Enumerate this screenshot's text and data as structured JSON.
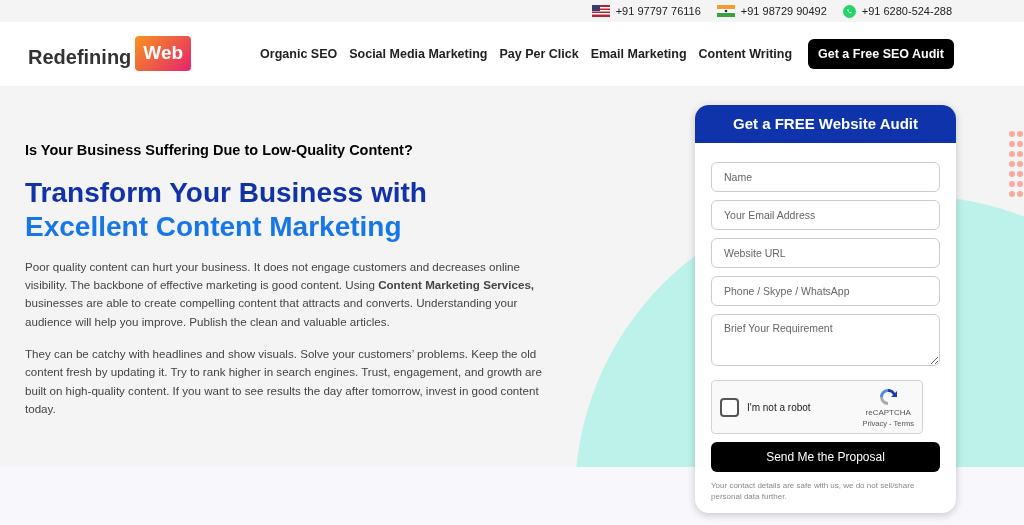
{
  "top_bar": {
    "contacts": [
      {
        "kind": "us",
        "number": "+91 97797 76116"
      },
      {
        "kind": "in",
        "number": "+91 98729 90492"
      },
      {
        "kind": "whatsapp",
        "number": "+91 6280-524-288"
      }
    ]
  },
  "header": {
    "logo": {
      "text": "Redefining",
      "badge": "Web"
    },
    "nav": [
      "Organic SEO",
      "Social Media Marketing",
      "Pay Per Click",
      "Email Marketing",
      "Content Writing"
    ],
    "cta": "Get a Free SEO Audit"
  },
  "hero": {
    "kicker": "Is Your Business Suffering Due to Low-Quality Content?",
    "title_line_1": "Transform Your Business with",
    "title_line_2": "Excellent Content Marketing",
    "paragraphs": [
      "Poor quality content can hurt your business. It does not engage customers and decreases online visibility. The backbone of effective marketing is good content. Using **Content Marketing Services,** businesses are able to create compelling content that attracts and converts. Understanding your audience will help you improve. Publish the clean and valuable articles.",
      "They can be catchy with headlines and show visuals. Solve your customers’ problems. Keep the old content fresh by updating it. Try to rank higher in search engines. Trust, engagement, and growth are built on high-quality content. If you want to see results the day after tomorrow, invest in good content today."
    ]
  },
  "form": {
    "title": "Get a FREE Website Audit",
    "fields": [
      {
        "kind": "input",
        "placeholder": "Name"
      },
      {
        "kind": "input",
        "placeholder": "Your Email Address"
      },
      {
        "kind": "input",
        "placeholder": "Website URL"
      },
      {
        "kind": "input",
        "placeholder": "Phone / Skype / WhatsApp"
      },
      {
        "kind": "textarea",
        "placeholder": "Brief Your Requirement"
      }
    ],
    "captcha": {
      "label": "I'm not a robot",
      "checked": false,
      "brand": "reCAPTCHA",
      "links": "Privacy - Terms"
    },
    "submit": "Send Me the Proposal",
    "note": "Your contact details are safe with us, we do not sell/share personal data further."
  }
}
